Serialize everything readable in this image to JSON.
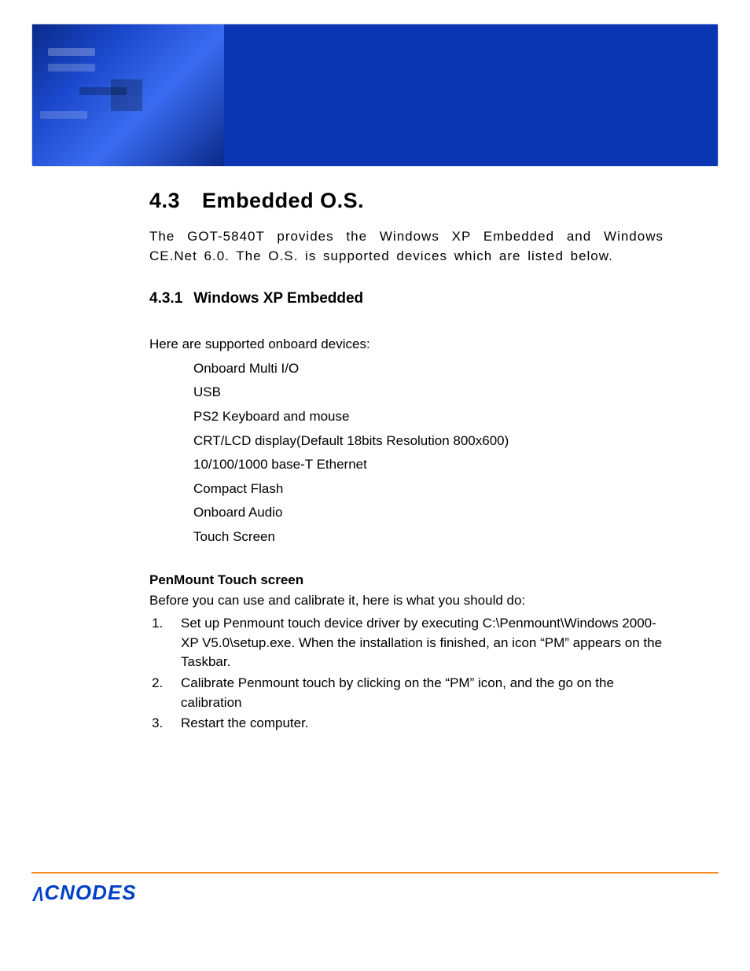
{
  "section": {
    "number": "4.3",
    "title": "Embedded O.S."
  },
  "intro": "The GOT-5840T provides the Windows XP Embedded and Windows CE.Net 6.0. The O.S. is supported devices which are listed below.",
  "subsection": {
    "number": "4.3.1",
    "title": "Windows XP Embedded"
  },
  "devices_lead": "Here are supported onboard devices:",
  "devices": [
    "Onboard Multi I/O",
    "USB",
    "PS2 Keyboard and mouse",
    "CRT/LCD display(Default 18bits Resolution 800x600)",
    "10/100/1000 base-T Ethernet",
    "Compact Flash",
    "Onboard Audio",
    "Touch Screen"
  ],
  "penmount": {
    "heading": "PenMount Touch screen",
    "before": "Before you can use and calibrate it, here is what you should do:",
    "steps": [
      "Set up Penmount touch device driver by executing C:\\Penmount\\Windows 2000-XP V5.0\\setup.exe. When the installation is finished, an icon “PM” appears on the Taskbar.",
      "Calibrate Penmount touch by clicking on the “PM” icon, and the go on the calibration",
      "Restart the computer."
    ]
  },
  "brand": "ACNODES"
}
